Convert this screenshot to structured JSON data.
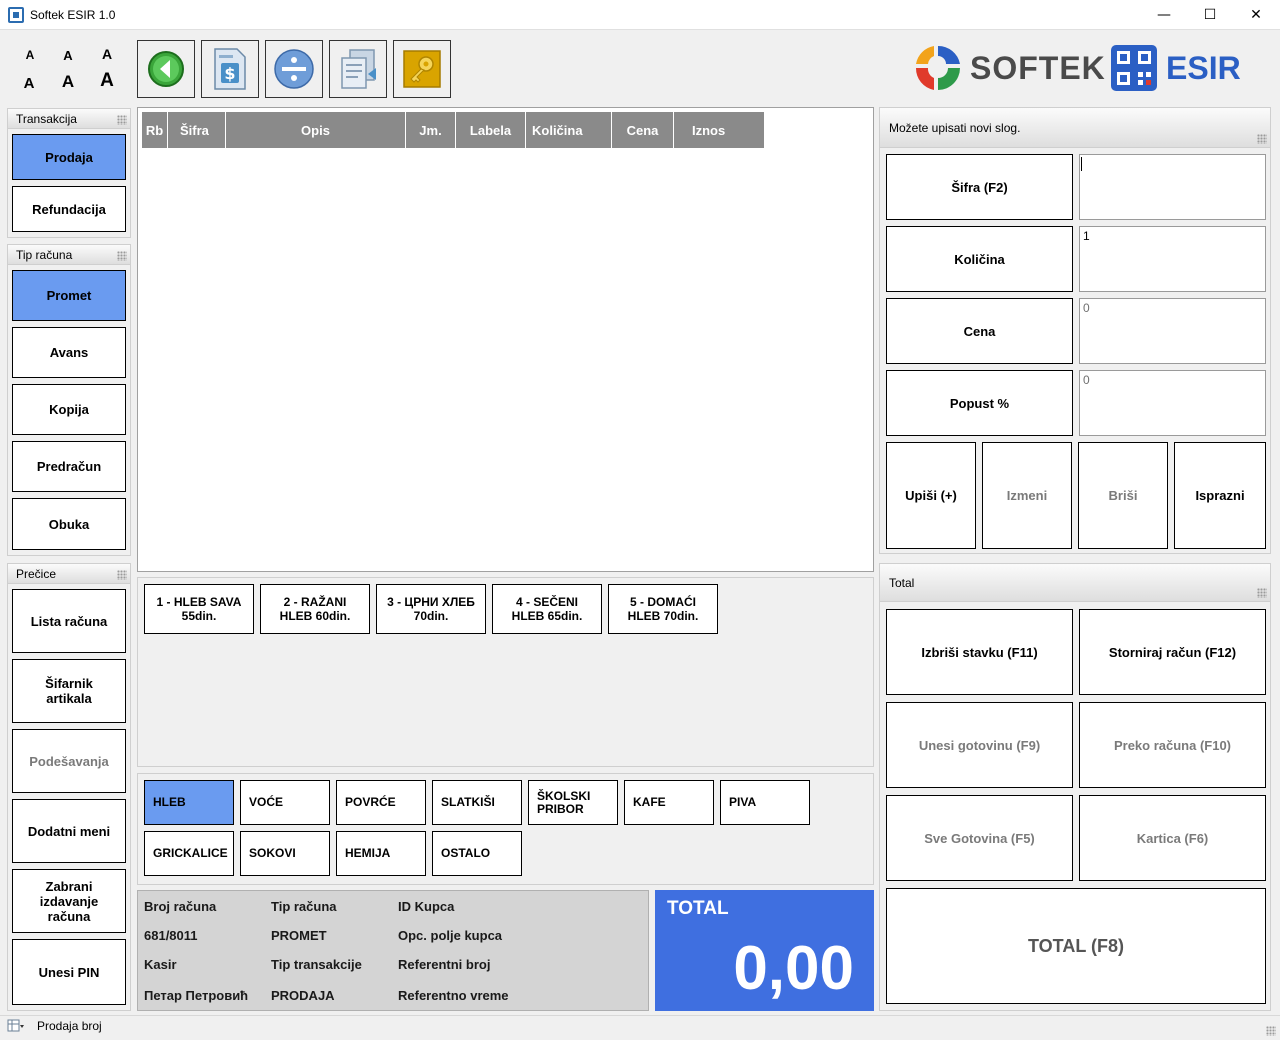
{
  "window": {
    "title": "Softek ESIR 1.0",
    "minimize": "—",
    "maximize": "☐",
    "close": "✕"
  },
  "font_sizes": [
    "A",
    "A",
    "A",
    "A",
    "A",
    "A"
  ],
  "logo": {
    "brand": "SOFTEK",
    "product": "ESIR"
  },
  "transakcija": {
    "title": "Transakcija",
    "items": [
      "Prodaja",
      "Refundacija"
    ]
  },
  "tip_racuna": {
    "title": "Tip računa",
    "items": [
      "Promet",
      "Avans",
      "Kopija",
      "Predračun",
      "Obuka"
    ]
  },
  "precice": {
    "title": "Prečice",
    "items": [
      "Lista računa",
      "Šifarnik artikala",
      "Podešavanja",
      "Dodatni meni",
      "Zabrani izdavanje računa",
      "Unesi PIN"
    ]
  },
  "grid": {
    "columns": [
      "Rb",
      "Šifra",
      "Opis",
      "Jm.",
      "Labela",
      "Količina",
      "Cena",
      "Iznos"
    ]
  },
  "quick_items": [
    "1 - HLEB SAVA\n55din.",
    "2 - RAŽANI\nHLEB  60din.",
    "3 - ЦРНИ ХЛЕБ\n70din.",
    "4 - SEČENI\nHLEB  65din.",
    "5 - DOMAĆI\nHLEB  70din."
  ],
  "categories": [
    "HLEB",
    "VOĆE",
    "POVRĆE",
    "SLATKIŠI",
    "ŠKOLSKI\nPRIBOR",
    "KAFE",
    "PIVA",
    "GRICKALICE",
    "SOKOVI",
    "HEMIJA",
    "OSTALO"
  ],
  "info": {
    "broj_racuna_label": "Broj računa",
    "broj_racuna": "681/8011",
    "tip_racuna_label": "Tip računa",
    "tip_racuna": "PROMET",
    "id_kupca_label": "ID Kupca",
    "opc_polje_label": "Opc. polje kupca",
    "kasir_label": "Kasir",
    "kasir": "Петар Петровић",
    "tip_transakcije_label": "Tip transakcije",
    "tip_transakcije": "PRODAJA",
    "referentni_broj_label": "Referentni broj",
    "referentno_vreme_label": "Referentno vreme"
  },
  "total_box": {
    "label": "TOTAL",
    "value": "0,00"
  },
  "entry": {
    "hint": "Možete upisati novi slog.",
    "sifra_label": "Šifra (F2)",
    "sifra_value": "",
    "kolicina_label": "Količina",
    "kolicina_value": "1",
    "cena_label": "Cena",
    "cena_value": "0",
    "popust_label": "Popust %",
    "popust_value": "0",
    "upisi": "Upiši (+)",
    "izmeni": "Izmeni",
    "brisi": "Briši",
    "isprazni": "Isprazni"
  },
  "total_panel": {
    "title": "Total",
    "izbrisi": "Izbriši stavku (F11)",
    "storniraj": "Storniraj račun (F12)",
    "unesi_gotovinu": "Unesi gotovinu (F9)",
    "preko_racuna": "Preko računa (F10)",
    "sve_gotovina": "Sve Gotovina (F5)",
    "kartica": "Kartica (F6)",
    "total_f8": "TOTAL (F8)"
  },
  "statusbar": {
    "text": "Prodaja broj"
  },
  "colors": {
    "selected": "#6a9bf0",
    "total_bg": "#3f6fe0",
    "grid_header": "#8a8a8a"
  }
}
